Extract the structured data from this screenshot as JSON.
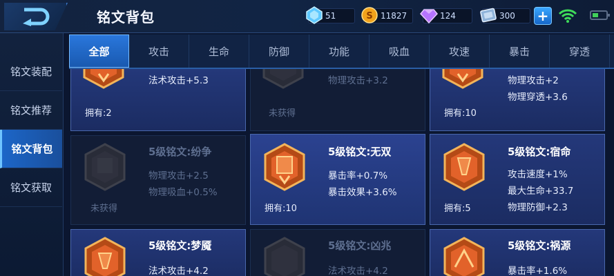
{
  "header": {
    "title": "铭文背包",
    "resources": [
      {
        "icon": "diamond-icon",
        "value": "51"
      },
      {
        "icon": "gold-coin-icon",
        "value": "11827"
      },
      {
        "icon": "purple-gem-icon",
        "value": "124"
      },
      {
        "icon": "coupon-icon",
        "value": "300"
      }
    ]
  },
  "sidebar": {
    "items": [
      {
        "label": "铭文装配"
      },
      {
        "label": "铭文推荐"
      },
      {
        "label": "铭文背包"
      },
      {
        "label": "铭文获取"
      }
    ],
    "active_index": 2
  },
  "tabs": {
    "items": [
      "全部",
      "攻击",
      "生命",
      "防御",
      "功能",
      "吸血",
      "攻速",
      "暴击",
      "穿透"
    ],
    "active_index": 0
  },
  "cards": [
    {
      "name": "",
      "attrs": [
        "法术攻击+5.3"
      ],
      "own": "拥有:2",
      "state": "owned"
    },
    {
      "name": "",
      "attrs": [
        "物理攻击+3.2"
      ],
      "own": "未获得",
      "state": "locked"
    },
    {
      "name": "",
      "attrs": [
        "物理攻击+2",
        "物理穿透+3.6"
      ],
      "own": "拥有:10",
      "state": "owned"
    },
    {
      "name": "5级铭文:纷争",
      "attrs": [
        "物理攻击+2.5",
        "物理吸血+0.5%"
      ],
      "own": "未获得",
      "state": "locked"
    },
    {
      "name": "5级铭文:无双",
      "attrs": [
        "暴击率+0.7%",
        "暴击效果+3.6%"
      ],
      "own": "拥有:10",
      "state": "owned-hl"
    },
    {
      "name": "5级铭文:宿命",
      "attrs": [
        "攻击速度+1%",
        "最大生命+33.7",
        "物理防御+2.3"
      ],
      "own": "拥有:5",
      "state": "owned"
    },
    {
      "name": "5级铭文:梦魇",
      "attrs": [
        "法术攻击+4.2"
      ],
      "own": "",
      "state": "owned"
    },
    {
      "name": "5级铭文:凶兆",
      "attrs": [
        "法术攻击+4.2"
      ],
      "own": "",
      "state": "locked"
    },
    {
      "name": "5级铭文:祸源",
      "attrs": [
        "暴击率+1.6%"
      ],
      "own": "",
      "state": "owned"
    }
  ]
}
